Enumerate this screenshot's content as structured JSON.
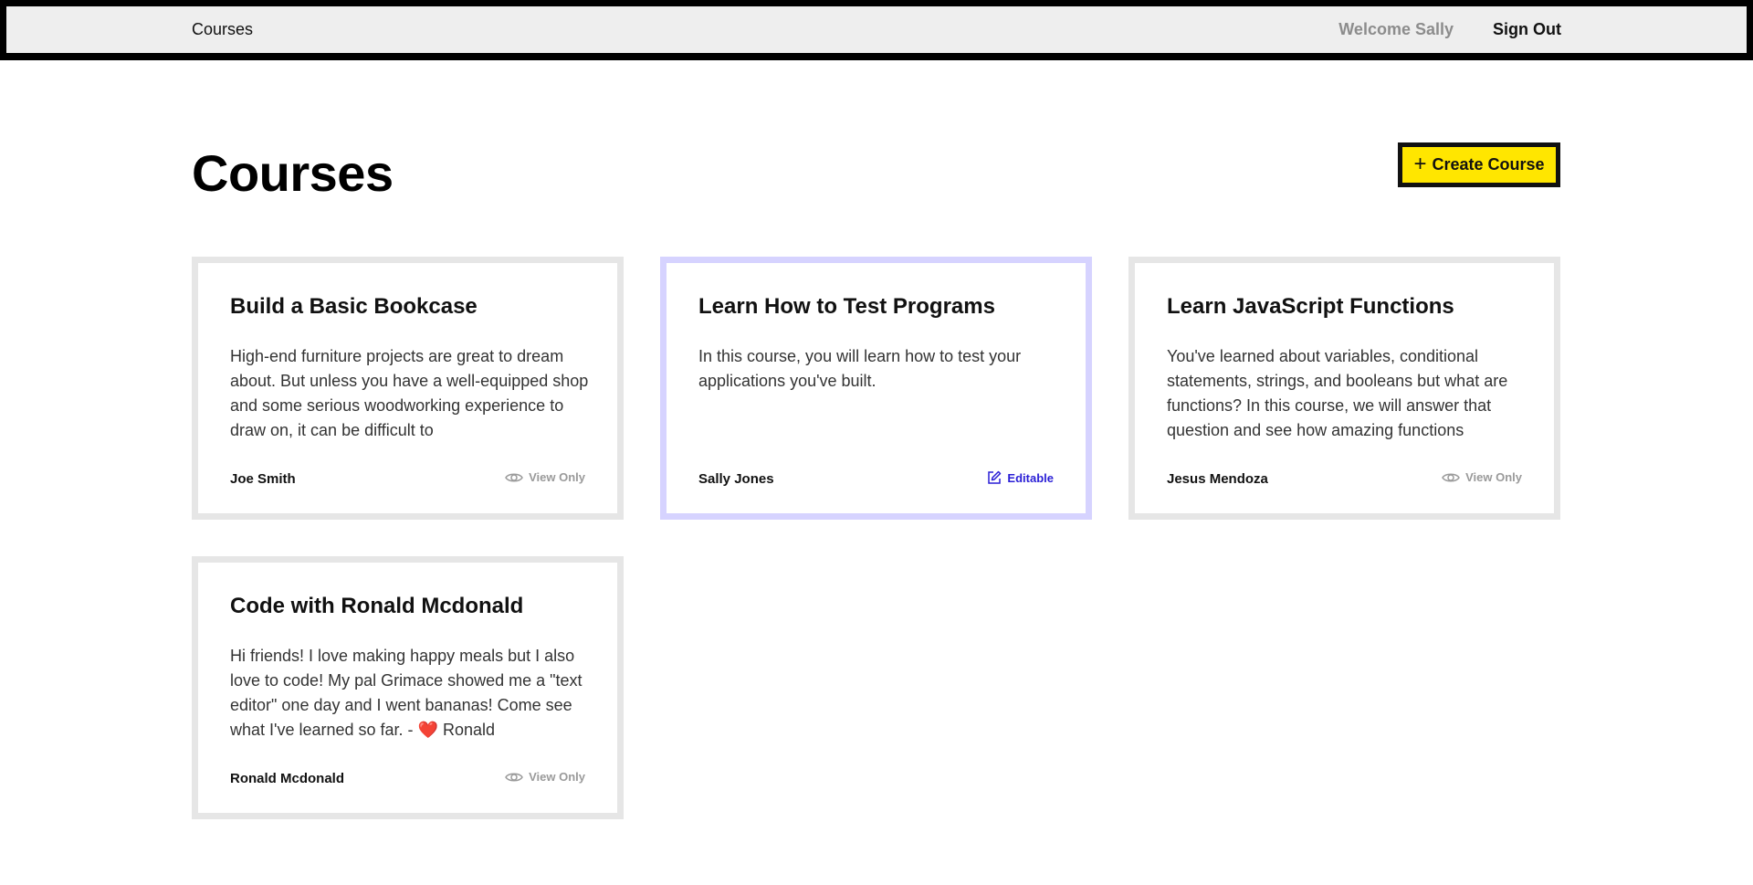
{
  "nav": {
    "brand": "Courses",
    "welcome": "Welcome Sally",
    "sign_out": "Sign Out"
  },
  "header": {
    "title": "Courses",
    "create_button": "Create Course",
    "create_icon": "plus-icon"
  },
  "courses": [
    {
      "title": "Build a Basic Bookcase",
      "description": "High-end furniture projects are great to dream about. But unless you have a well-equipped shop and some serious woodworking experience to draw on, it can be difficult to",
      "author": "Joe Smith",
      "access": "View Only",
      "access_icon": "eye-icon"
    },
    {
      "title": "Learn How to Test Programs",
      "description": "In this course, you will learn how to test your applications you've built.",
      "author": "Sally Jones",
      "access": "Editable",
      "access_icon": "edit-icon"
    },
    {
      "title": "Learn JavaScript Functions",
      "description": "You've learned about variables, conditional statements, strings, and booleans but what are functions? In this course, we will answer that question and see how amazing functions",
      "author": "Jesus Mendoza",
      "access": "View Only",
      "access_icon": "eye-icon"
    },
    {
      "title": "Code with Ronald Mcdonald",
      "description": "Hi friends! I love making happy meals but I also love to code! My pal Grimace showed me a \"text editor\" one day and I went bananas! Come see what I've learned so far. - ❤️ Ronald",
      "author": "Ronald Mcdonald",
      "access": "View Only",
      "access_icon": "eye-icon"
    }
  ],
  "colors": {
    "accent_yellow": "#ffe600",
    "editable_border": "#d6d3ff",
    "editable_text": "#2a1fd6",
    "card_border": "#e6e6e6",
    "nav_bg": "#eeeeee"
  }
}
